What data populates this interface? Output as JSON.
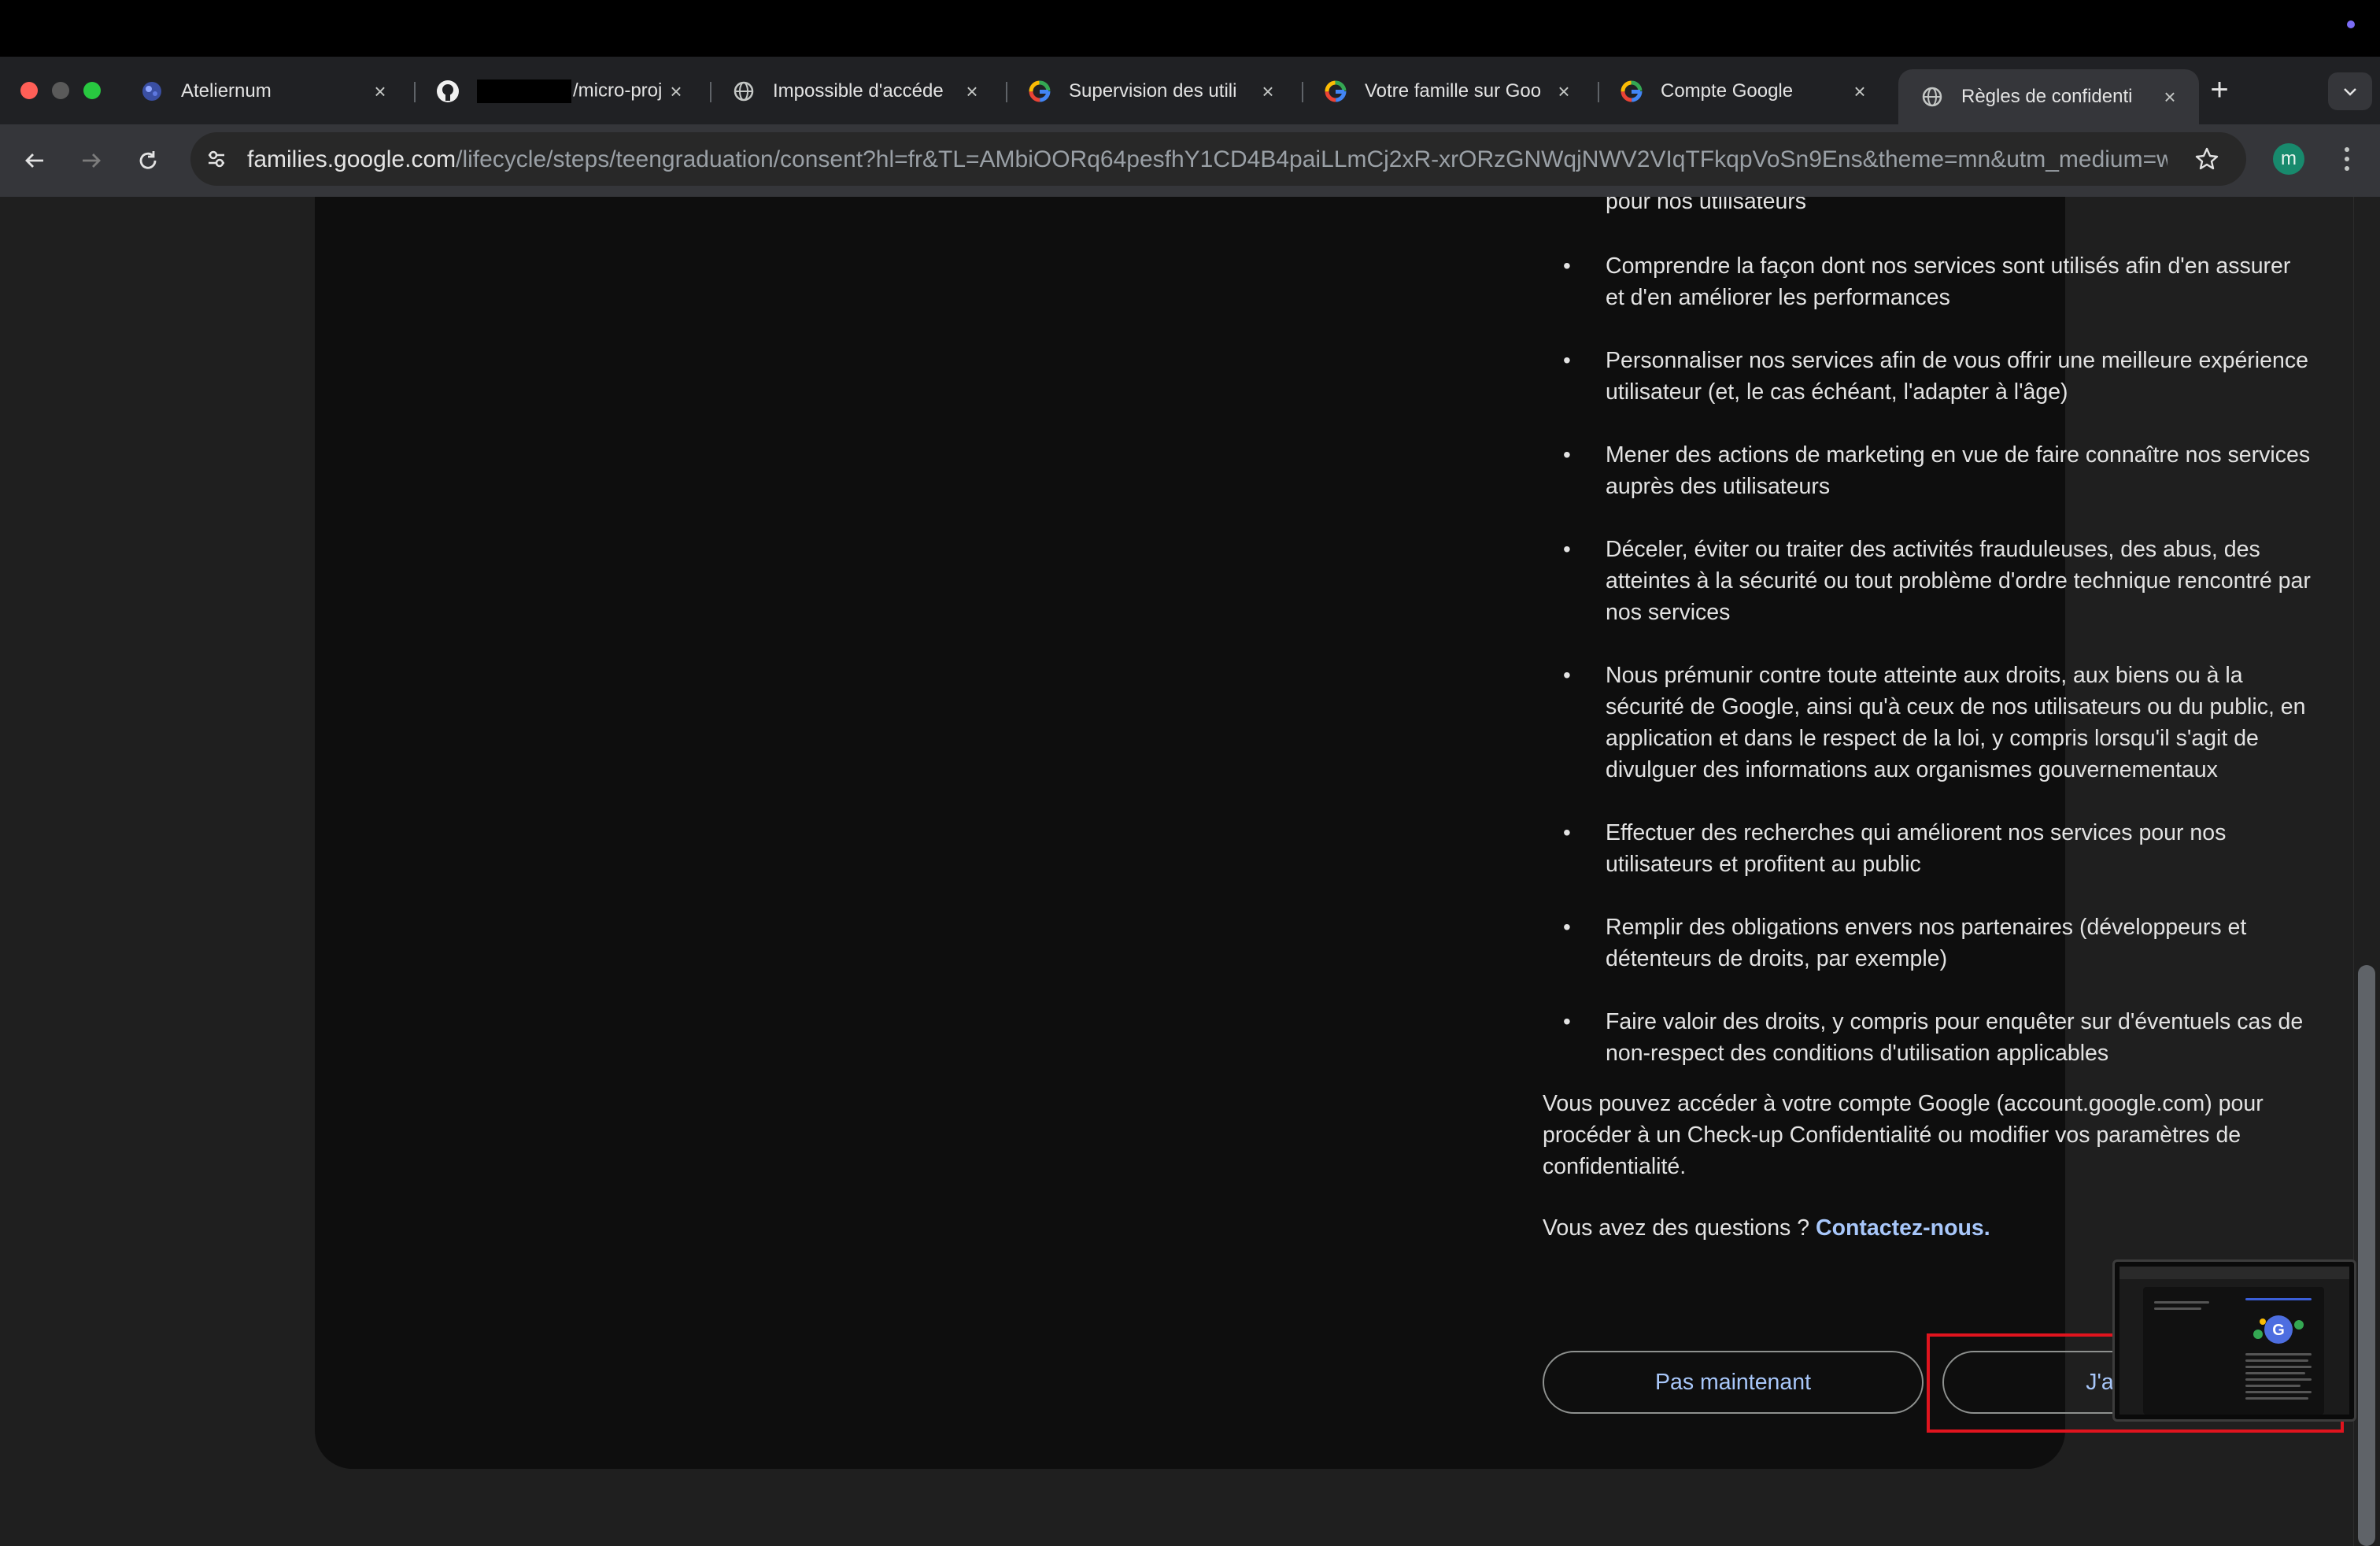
{
  "browser": {
    "tabs": [
      {
        "title": "Ateliernum",
        "icon": "globe-blue-icon"
      },
      {
        "title": "/micro-proj",
        "icon": "github-icon"
      },
      {
        "title": "Impossible d'accéde",
        "icon": "globe-icon"
      },
      {
        "title": "Supervision des utili",
        "icon": "google-g-icon"
      },
      {
        "title": "Votre famille sur Goo",
        "icon": "google-g-icon"
      },
      {
        "title": "Compte Google",
        "icon": "google-g-icon"
      },
      {
        "title": "Règles de confidenti",
        "icon": "globe-icon",
        "active": true
      }
    ],
    "new_tab_label": "+",
    "url_host": "families.google.com",
    "url_path": "/lifecycle/steps/teengraduation/consent?hl=fr&TL=AMbiOORq64pesfhY1CD4B4paiLLmCj2xR-xrORzGNWqjNWV2VIqTFkqpVoSn9Ens&theme=mn&utm_medium=we...",
    "profile_initial": "m"
  },
  "page": {
    "purposes": [
      {
        "text": "Développer de nouveaux produits et de nouvelles fonctionnalités utiles pour nos utilisateurs"
      },
      {
        "text": "Comprendre la façon dont nos services sont utilisés afin d'en assurer et d'en améliorer les performances"
      },
      {
        "text": "Personnaliser nos services afin de vous offrir une meilleure expérience utilisateur (et, le cas échéant, l'adapter à l'âge)"
      },
      {
        "text": "Mener des actions de marketing en vue de faire connaître nos services auprès des utilisateurs"
      },
      {
        "text": "Déceler, éviter ou traiter des activités frauduleuses, des abus, des atteintes à la sécurité ou tout problème d'ordre technique rencontré par nos services"
      },
      {
        "text": "Nous prémunir contre toute atteinte aux droits, aux biens ou à la sécurité de Google, ainsi qu'à ceux de nos utilisateurs ou du public, en application et dans le respect de la loi, y compris lorsqu'il s'agit de divulguer des informations aux organismes gouvernementaux"
      },
      {
        "text": "Effectuer des recherches qui améliorent nos services pour nos utilisateurs et profitent au public"
      },
      {
        "text": "Remplir des obligations envers nos partenaires (développeurs et détenteurs de droits, par exemple)"
      },
      {
        "text": "Faire valoir des droits, y compris pour enquêter sur d'éventuels cas de non-respect des conditions d'utilisation applicables"
      }
    ],
    "account_paragraph": "Vous pouvez accéder à votre compte Google (account.google.com) pour procéder à un Check-up Confidentialité ou modifier vos paramètres de confidentialité.",
    "questions_prefix": "Vous avez des questions ? ",
    "contact_link": "Contactez-nous.",
    "btn_not_now": "Pas maintenant",
    "btn_accept": "J'accepte"
  },
  "colors": {
    "link": "#a8c7fa",
    "highlight": "#e0141e",
    "avatar": "#188a6d"
  }
}
